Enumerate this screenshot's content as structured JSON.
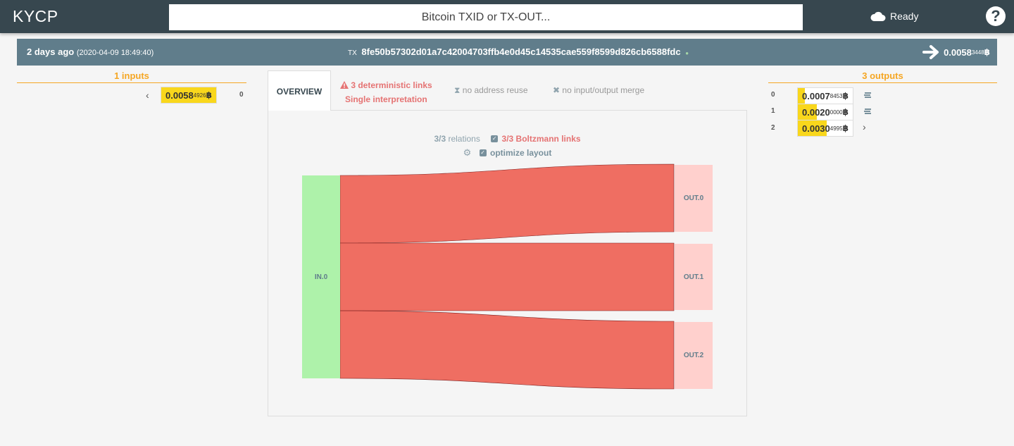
{
  "header": {
    "brand": "KYCP",
    "search_placeholder": "Bitcoin TXID or TX-OUT...",
    "status": "Ready",
    "help": "?"
  },
  "tx": {
    "age": "2 days ago",
    "date": "(2020-04-09 18:49:40)",
    "prefix": "TX",
    "txid": "8fe50b57302d01a7c42004703ffb4e0d45c14535cae559f8599d826cb6588fdc",
    "total_main": "0.0058",
    "total_small": "3448",
    "currency": "฿"
  },
  "inputs": {
    "heading": "1 inputs",
    "items": [
      {
        "index": "0",
        "main": "0.0058",
        "small": "4926",
        "fill": 1.0
      }
    ]
  },
  "outputs": {
    "heading": "3 outputs",
    "items": [
      {
        "index": "0",
        "main": "0.0007",
        "small": "8453",
        "fill": 0.13
      },
      {
        "index": "1",
        "main": "0.0020",
        "small": "0000",
        "fill": 0.34
      },
      {
        "index": "2",
        "main": "0.0030",
        "small": "4995",
        "fill": 0.52
      }
    ]
  },
  "tabs": {
    "overview": "OVERVIEW",
    "warn_line1": "3 deterministic links",
    "warn_line2": "Single interpretation",
    "reuse": "no address reuse",
    "merge": "no input/output merge"
  },
  "options": {
    "relations": "3/3",
    "relations_label": "relations",
    "boltzmann": "3/3 Boltzmann links",
    "optimize": "optimize layout"
  },
  "sankey": {
    "input_node": "IN.0",
    "output_nodes": [
      "OUT.0",
      "OUT.1",
      "OUT.2"
    ],
    "colors": {
      "input": "#aef2aa",
      "output": "#ffd0cd",
      "link": "#ef6e62",
      "link_stroke": "#7a1f1f"
    }
  }
}
